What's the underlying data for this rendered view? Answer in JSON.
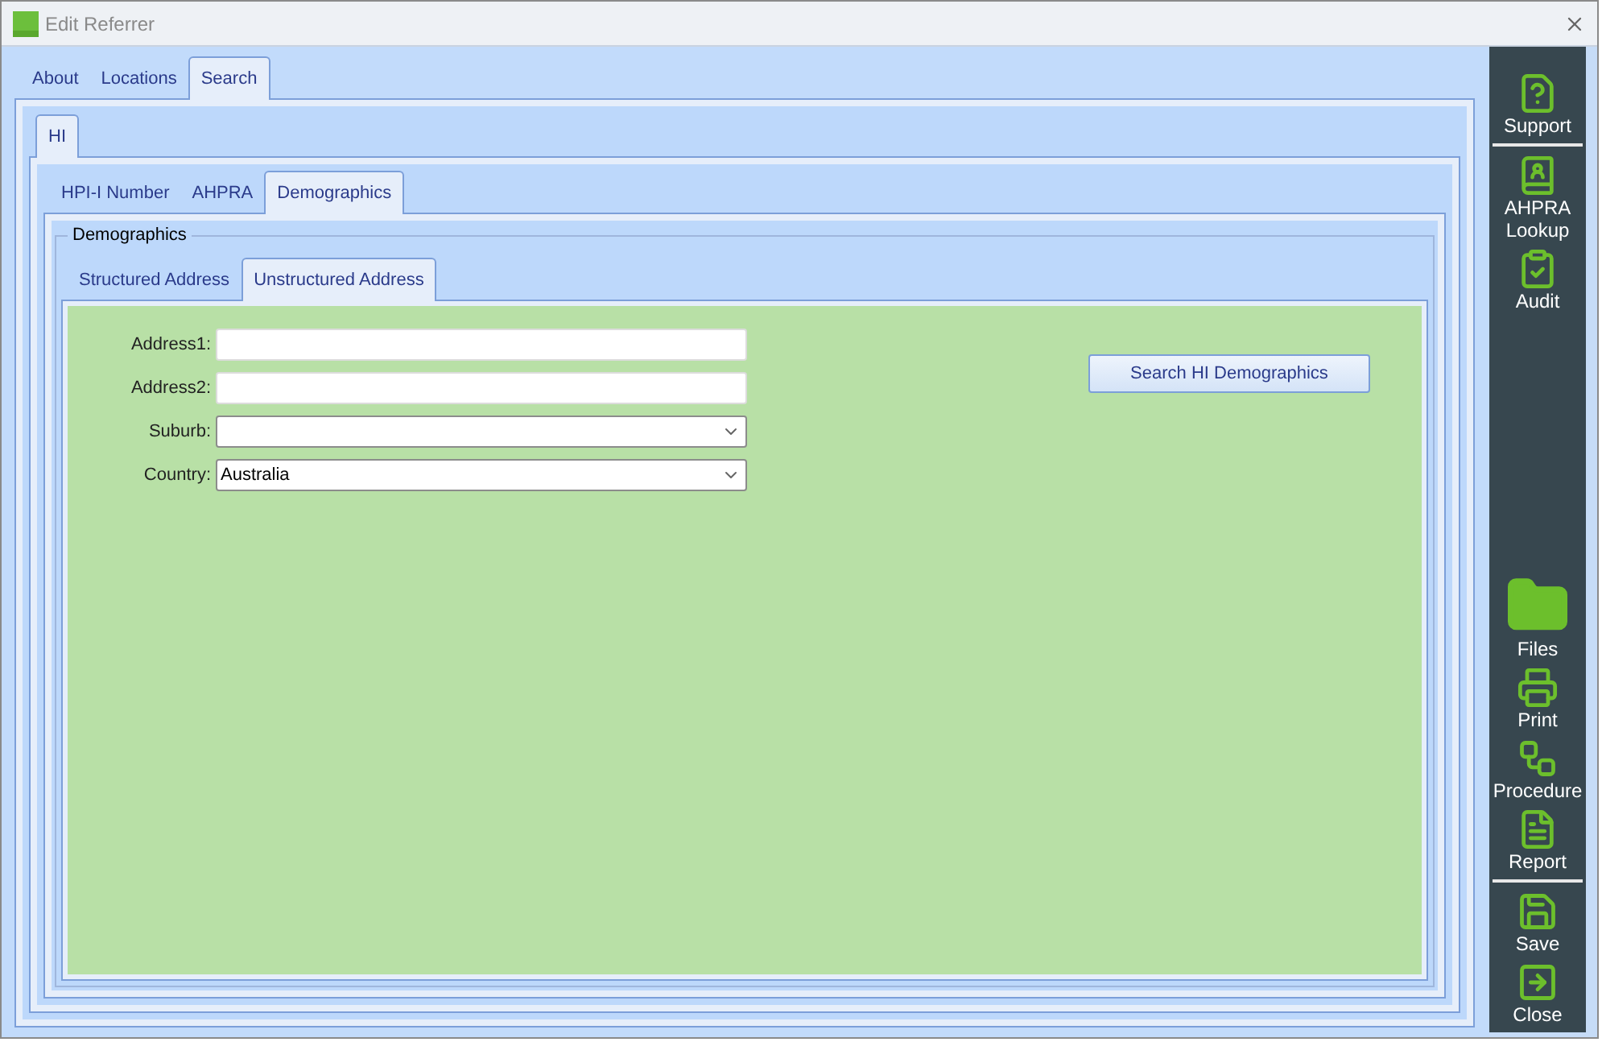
{
  "window": {
    "title": "Edit Referrer"
  },
  "tabs": [
    {
      "label": "About",
      "selected": false
    },
    {
      "label": "Locations",
      "selected": false
    },
    {
      "label": "Search",
      "selected": true
    }
  ],
  "hi_tabs": [
    {
      "label": "HI",
      "selected": true
    }
  ],
  "search_tabs": [
    {
      "label": "HPI-I Number",
      "selected": false
    },
    {
      "label": "AHPRA",
      "selected": false
    },
    {
      "label": "Demographics",
      "selected": true
    }
  ],
  "group_title": "Demographics",
  "address_tabs": [
    {
      "label": "Structured Address",
      "selected": false
    },
    {
      "label": "Unstructured Address",
      "selected": true
    }
  ],
  "fields": [
    {
      "label": "Address1:",
      "kind": "text"
    },
    {
      "label": "Address2:",
      "kind": "text"
    },
    {
      "label": "Suburb:",
      "kind": "select"
    },
    {
      "label": "Country:",
      "kind": "select",
      "value": "Australia"
    }
  ],
  "search_button": "Search HI Demographics",
  "sidebar": {
    "top": [
      {
        "label": "Support",
        "divider_after": true
      },
      {
        "label": "AHPRA Lookup",
        "divider_after": false
      },
      {
        "label": "Audit",
        "divider_after": false
      }
    ],
    "bottom": [
      {
        "label": "Files",
        "divider_after": false
      },
      {
        "label": "Print",
        "divider_after": false
      },
      {
        "label": "Procedure",
        "divider_after": false
      },
      {
        "label": "Report",
        "divider_after": true
      },
      {
        "label": "Save",
        "divider_after": false
      },
      {
        "label": "Close",
        "divider_after": false
      }
    ]
  }
}
